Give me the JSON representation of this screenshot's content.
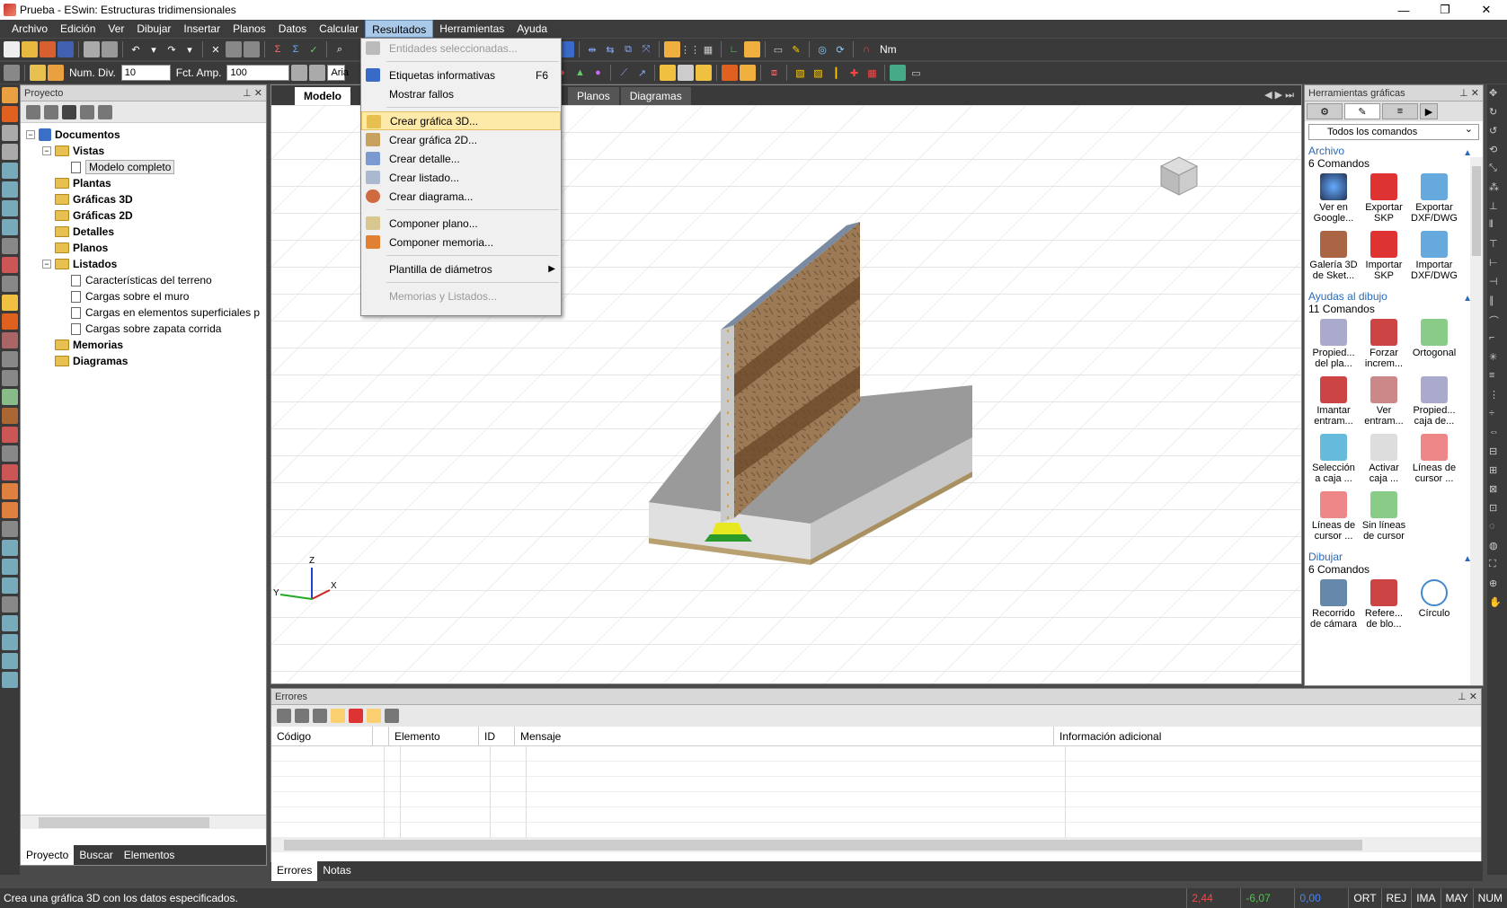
{
  "window": {
    "title": "Prueba - ESwin: Estructuras tridimensionales",
    "minimize": "—",
    "restore": "❐",
    "close": "✕"
  },
  "menubar": [
    "Archivo",
    "Edición",
    "Ver",
    "Dibujar",
    "Insertar",
    "Planos",
    "Datos",
    "Calcular",
    "Resultados",
    "Herramientas",
    "Ayuda"
  ],
  "toolbar2": {
    "num_div_label": "Num. Div.",
    "num_div_value": "10",
    "fct_amp_label": "Fct. Amp.",
    "fct_amp_value": "100",
    "font_value": "Aria",
    "nm_label": "Nm"
  },
  "project": {
    "title": "Proyecto",
    "tree": {
      "documentos": "Documentos",
      "vistas": "Vistas",
      "modelo_completo": "Modelo completo",
      "plantas": "Plantas",
      "graficas3d": "Gráficas 3D",
      "graficas2d": "Gráficas 2D",
      "detalles": "Detalles",
      "planos": "Planos",
      "listados": "Listados",
      "listado_items": [
        "Características del terreno",
        "Cargas sobre el muro",
        "Cargas en elementos superficiales p",
        "Cargas sobre zapata corrida"
      ],
      "memorias": "Memorias",
      "diagramas": "Diagramas"
    },
    "tabs": [
      "Proyecto",
      "Buscar",
      "Elementos"
    ]
  },
  "viewport": {
    "tabs": [
      "Modelo",
      "Planos",
      "Diagramas"
    ],
    "axes": {
      "z": "Z",
      "y": "Y",
      "x": "X"
    }
  },
  "resultados_menu": {
    "items": [
      {
        "label": "Entidades seleccionadas...",
        "disabled": true
      },
      {
        "label": "Etiquetas informativas",
        "shortcut": "F6"
      },
      {
        "label": "Mostrar fallos"
      },
      {
        "label": "Crear gráfica 3D...",
        "selected": true
      },
      {
        "label": "Crear gráfica 2D..."
      },
      {
        "label": "Crear detalle..."
      },
      {
        "label": "Crear listado..."
      },
      {
        "label": "Crear diagrama..."
      },
      {
        "label": "Componer plano..."
      },
      {
        "label": "Componer memoria..."
      },
      {
        "label": "Plantilla de diámetros",
        "submenu": true
      },
      {
        "label": "Memorias y Listados...",
        "disabled": true
      }
    ]
  },
  "tools": {
    "title": "Herramientas gráficas",
    "filter": "Todos los comandos",
    "groups": [
      {
        "title": "Archivo",
        "count": "6 Comandos",
        "items": [
          "Ver en Google...",
          "Exportar SKP",
          "Exportar DXF/DWG",
          "Galería 3D de Sket...",
          "Importar SKP",
          "Importar DXF/DWG"
        ]
      },
      {
        "title": "Ayudas al dibujo",
        "count": "11 Comandos",
        "items": [
          "Propied... del pla...",
          "Forzar increm...",
          "Ortogonal",
          "Imantar entram...",
          "Ver entram...",
          "Propied... caja de...",
          "Selección a caja ...",
          "Activar caja ...",
          "Líneas de cursor ...",
          "Líneas de cursor ...",
          "Sin líneas de cursor"
        ]
      },
      {
        "title": "Dibujar",
        "count": "6 Comandos",
        "items": [
          "Recorrido de cámara",
          "Refere... de blo...",
          "Círculo"
        ]
      }
    ]
  },
  "errors": {
    "title": "Errores",
    "columns": [
      "Código",
      "Elemento",
      "ID",
      "Mensaje",
      "Información adicional"
    ],
    "tabs": [
      "Errores",
      "Notas"
    ]
  },
  "status": {
    "message": "Crea una gráfica 3D con los datos especificados.",
    "coord1": "2,44",
    "coord2": "-6,07",
    "coord3": "0,00",
    "flags": [
      "ORT",
      "REJ",
      "IMA",
      "MAY",
      "NUM"
    ]
  }
}
